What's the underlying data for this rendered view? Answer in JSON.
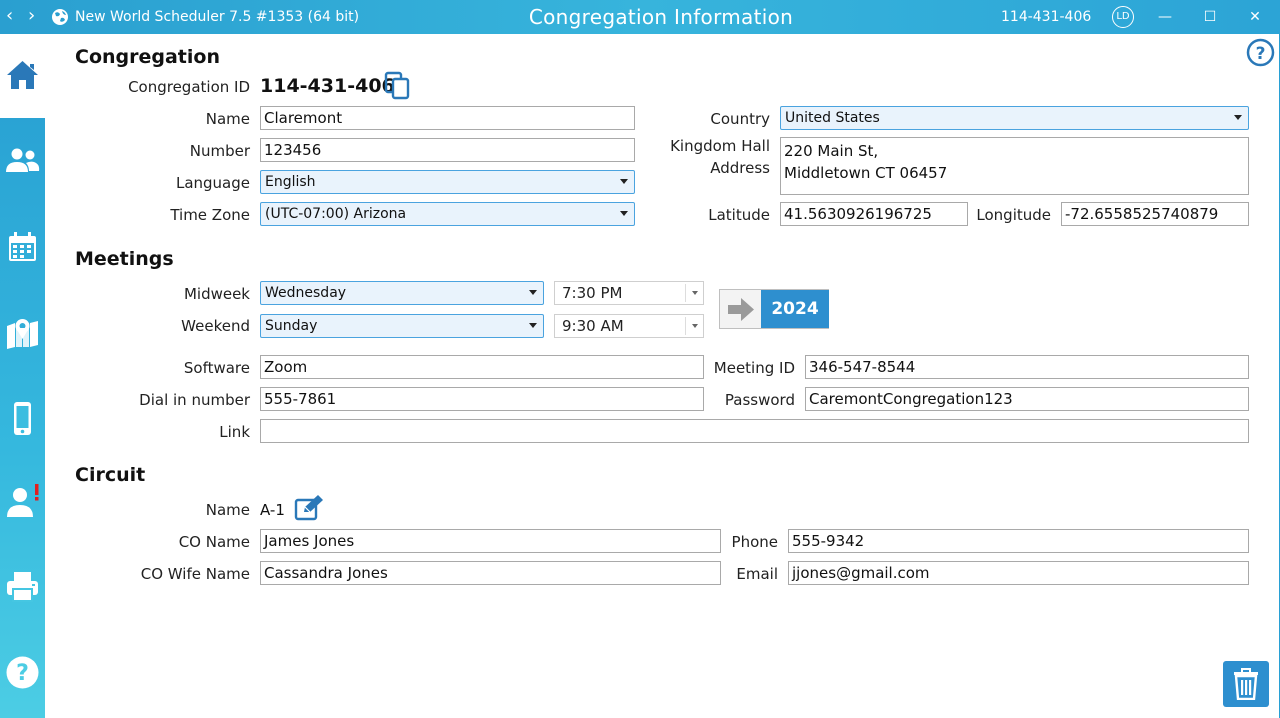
{
  "titlebar": {
    "back": "‹",
    "forward": "›",
    "app_title": "New World Scheduler 7.5 #1353 (64 bit)",
    "page_title": "Congregation Information",
    "congregation_id": "114-431-406",
    "user_initials": "LD",
    "minimize": "—",
    "maximize": "☐",
    "close": "✕"
  },
  "colors": {
    "accent": "#2aa3d4",
    "accent_dark": "#2a78b8",
    "select_bg": "#e9f3fc"
  },
  "sidebar": {
    "items": [
      {
        "icon": "home-icon"
      },
      {
        "icon": "people-icon"
      },
      {
        "icon": "calendar-icon"
      },
      {
        "icon": "map-icon"
      },
      {
        "icon": "phone-icon"
      },
      {
        "icon": "user-alert-icon",
        "badge": "!"
      },
      {
        "icon": "printer-icon"
      },
      {
        "icon": "help-icon",
        "glyph": "?"
      }
    ]
  },
  "help_glyph": "?",
  "congregation": {
    "heading": "Congregation",
    "id_label": "Congregation ID",
    "id_value": "114-431-406",
    "name_label": "Name",
    "name_value": "Claremont",
    "number_label": "Number",
    "number_value": "123456",
    "language_label": "Language",
    "language_value": "English",
    "timezone_label": "Time Zone",
    "timezone_value": "(UTC-07:00) Arizona",
    "country_label": "Country",
    "country_value": "United States",
    "address_label_1": "Kingdom Hall",
    "address_label_2": "Address",
    "address_value": "220 Main St,\nMiddletown CT 06457",
    "latitude_label": "Latitude",
    "latitude_value": "41.5630926196725",
    "longitude_label": "Longitude",
    "longitude_value": "-72.6558525740879"
  },
  "meetings": {
    "heading": "Meetings",
    "midweek_label": "Midweek",
    "midweek_day": "Wednesday",
    "midweek_time": "7:30 PM",
    "weekend_label": "Weekend",
    "weekend_day": "Sunday",
    "weekend_time": "9:30 AM",
    "year_button": "2024",
    "software_label": "Software",
    "software_value": "Zoom",
    "meeting_id_label": "Meeting ID",
    "meeting_id_value": "346-547-8544",
    "dialin_label": "Dial in number",
    "dialin_value": "555-7861",
    "password_label": "Password",
    "password_value": "CaremontCongregation123",
    "link_label": "Link",
    "link_value": ""
  },
  "circuit": {
    "heading": "Circuit",
    "name_label": "Name",
    "name_value": "A-1",
    "co_name_label": "CO Name",
    "co_name_value": "James Jones",
    "phone_label": "Phone",
    "phone_value": "555-9342",
    "co_wife_label": "CO Wife Name",
    "co_wife_value": "Cassandra Jones",
    "email_label": "Email",
    "email_value": "jjones@gmail.com"
  }
}
